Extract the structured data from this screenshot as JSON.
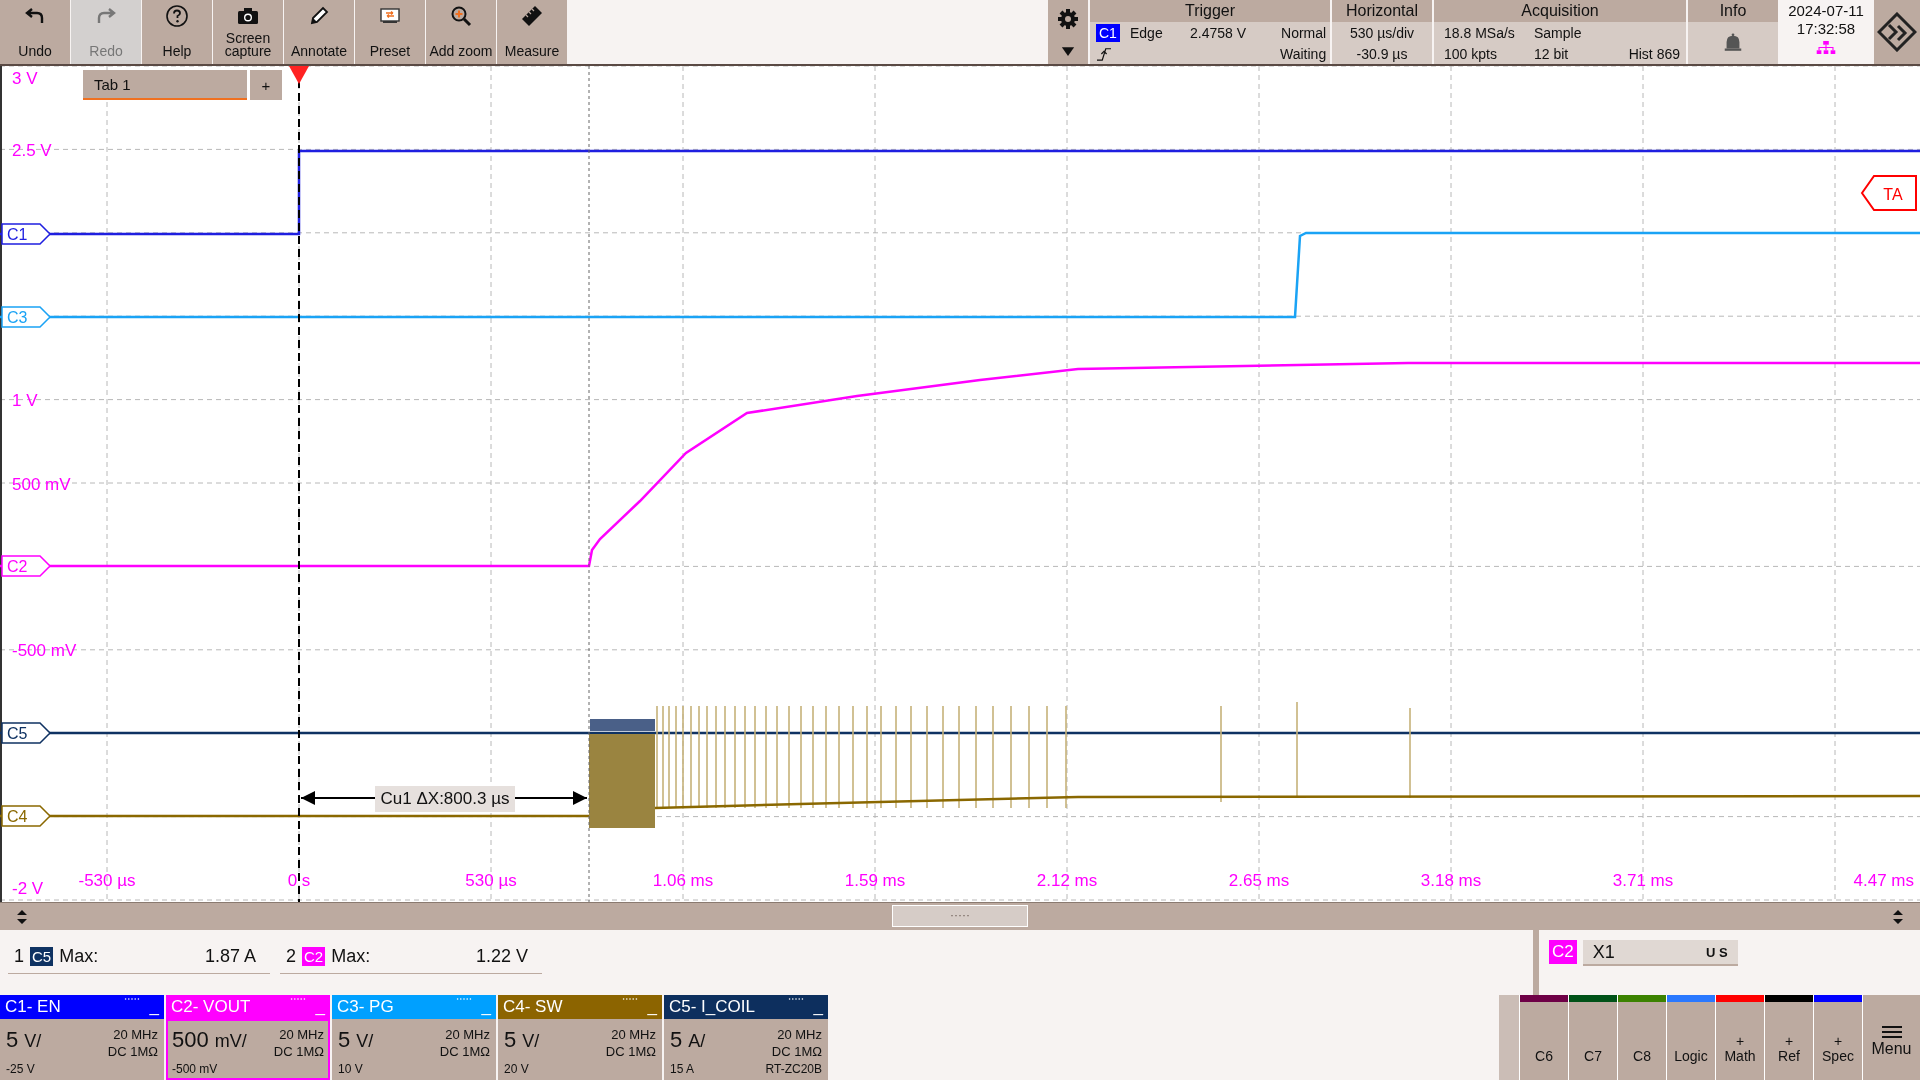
{
  "toolbar": {
    "buttons": [
      {
        "label": "Undo",
        "kind": "undo",
        "disabled": false
      },
      {
        "label": "Redo",
        "kind": "redo",
        "disabled": true
      },
      {
        "label": "Help",
        "kind": "help",
        "disabled": false
      },
      {
        "label": "Screen capture",
        "kind": "camera",
        "disabled": false
      },
      {
        "label": "Annotate",
        "kind": "pencil",
        "disabled": false
      },
      {
        "label": "Preset",
        "kind": "preset",
        "disabled": false
      },
      {
        "label": "Add zoom",
        "kind": "zoom",
        "disabled": false
      },
      {
        "label": "Measure",
        "kind": "ruler",
        "disabled": false
      }
    ]
  },
  "trigger": {
    "title": "Trigger",
    "source": "C1",
    "color": "#0000ff",
    "type": "Edge",
    "level": "2.4758 V",
    "mode": "Normal",
    "state": "Waiting"
  },
  "horizontal": {
    "title": "Horizontal",
    "scale": "530 µs/div",
    "position": "-30.9 µs"
  },
  "acquisition": {
    "title": "Acquisition",
    "rate": "18.8 MSa/s",
    "mode": "Sample",
    "points": "100 kpts",
    "resolution": "12 bit",
    "history": "Hist 869"
  },
  "info": {
    "title": "Info"
  },
  "datetime": {
    "date": "2024-07-11",
    "time": "17:32:58"
  },
  "plot": {
    "tab": {
      "label": "Tab 1",
      "add": "+"
    },
    "y_labels": [
      "3 V",
      "2.5 V",
      "1 V",
      "500 mV",
      "-500 mV",
      "-2 V"
    ],
    "x_labels": [
      "-530 µs",
      "0 s",
      "530 µs",
      "1.06 ms",
      "1.59 ms",
      "2.12 ms",
      "2.65 ms",
      "3.18 ms",
      "3.71 ms",
      "4.47 ms"
    ],
    "markers": [
      {
        "label": "C1",
        "color": "#1f1fe0"
      },
      {
        "label": "C3",
        "color": "#1aa3f5"
      },
      {
        "label": "C2",
        "color": "#ff00ff"
      },
      {
        "label": "C5",
        "color": "#0f3262"
      },
      {
        "label": "C4",
        "color": "#8a6800"
      }
    ],
    "cursor_label": "Cu1 ΔX:800.3 µs",
    "trigger_tag": "TA"
  },
  "scrollbar": {
    "thumb": "·····"
  },
  "measurements": [
    {
      "index": "1",
      "source": "C5",
      "color": "#0f3262",
      "label": "Max:",
      "value": "1.87 A"
    },
    {
      "index": "2",
      "source": "C2",
      "color": "#ff00ff",
      "label": "Max:",
      "value": "1.22 V"
    }
  ],
  "cursor_panel": {
    "source": "C2",
    "color": "#ff00ff",
    "name": "X1",
    "units": "U S"
  },
  "channels": [
    {
      "name": "C1- EN",
      "color": "#0000ff",
      "scale": "5",
      "unit": "V/",
      "bandwidth": "20 MHz",
      "coupling": "DC 1MΩ",
      "offset": "-25 V",
      "minimize": "_",
      "selected": false
    },
    {
      "name": "C2- VOUT",
      "color": "#ff00ff",
      "scale": "500",
      "unit": "mV/",
      "bandwidth": "20 MHz",
      "coupling": "DC 1MΩ",
      "offset": "-500 mV",
      "minimize": "_",
      "selected": true
    },
    {
      "name": "C3- PG",
      "color": "#00a0ff",
      "scale": "5",
      "unit": "V/",
      "bandwidth": "20 MHz",
      "coupling": "DC 1MΩ",
      "offset": "10 V",
      "minimize": "_",
      "selected": false
    },
    {
      "name": "C4- SW",
      "color": "#8c6400",
      "scale": "5",
      "unit": "V/",
      "bandwidth": "20 MHz",
      "coupling": "DC 1MΩ",
      "offset": "20 V",
      "minimize": "_",
      "selected": false
    },
    {
      "name": "C5- I_COIL",
      "color": "#0d2f5e",
      "scale": "5",
      "unit": "A/",
      "bandwidth": "20 MHz",
      "coupling": "DC 1MΩ",
      "offset": "15 A",
      "probe": "RT-ZC20B",
      "minimize": "_",
      "selected": false
    }
  ],
  "extra_buttons": [
    {
      "label": "C6",
      "color": "#6e0046"
    },
    {
      "label": "C7",
      "color": "#005218"
    },
    {
      "label": "C8",
      "color": "#3c8200"
    },
    {
      "label": "Logic",
      "color": "#2a78ff"
    },
    {
      "label": "Math",
      "plus": "+",
      "color": "#ff0000"
    },
    {
      "label": "Ref",
      "plus": "+",
      "color": "#000000"
    },
    {
      "label": "Spec",
      "plus": "+",
      "color": "#0000ff"
    }
  ],
  "menu": {
    "label": "Menu"
  }
}
